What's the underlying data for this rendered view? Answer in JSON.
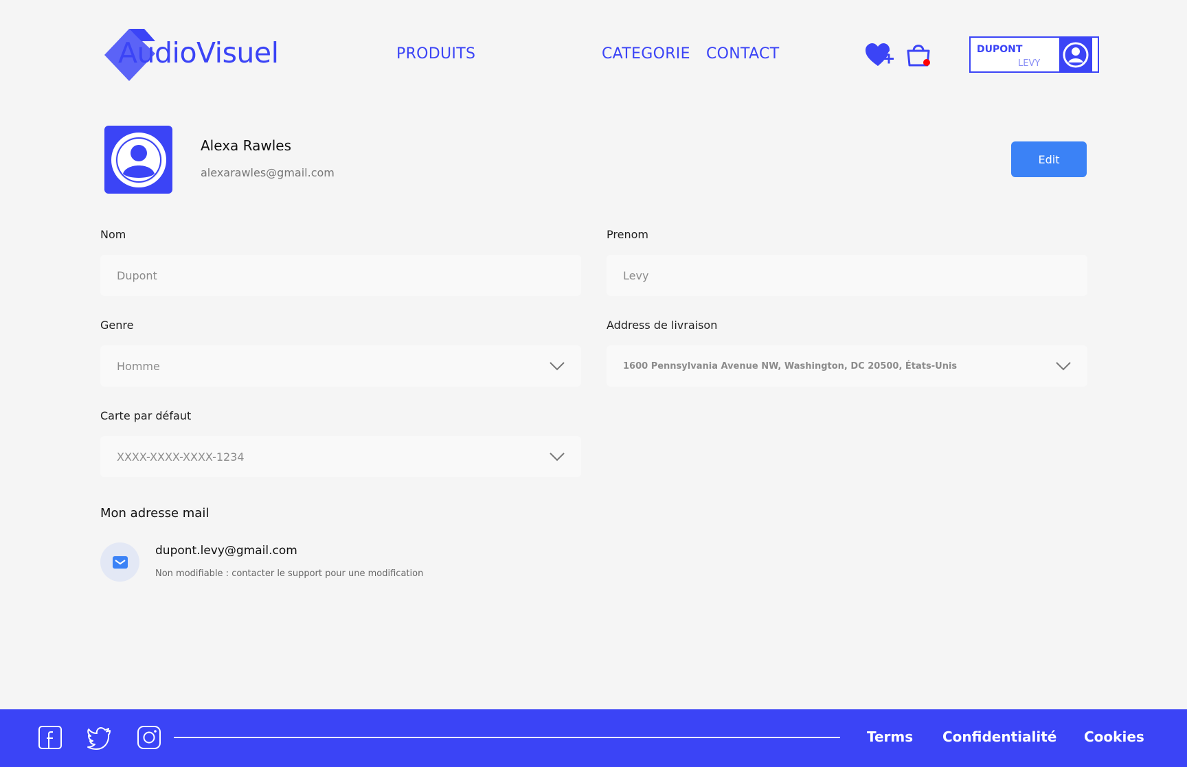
{
  "header": {
    "logo_text": "AudioVisuel",
    "nav": {
      "produits": "PRODUITS",
      "categorie": "CATEGORIE",
      "contact": "CONTACT"
    },
    "user": {
      "last_name": "DUPONT",
      "first_name": "LEVY"
    }
  },
  "profile": {
    "name": "Alexa Rawles",
    "email": "alexarawles@gmail.com",
    "edit_label": "Edit"
  },
  "form": {
    "nom": {
      "label": "Nom",
      "placeholder": "Dupont"
    },
    "prenom": {
      "label": "Prenom",
      "placeholder": "Levy"
    },
    "genre": {
      "label": "Genre",
      "value": "Homme"
    },
    "address": {
      "label": "Address de livraison",
      "value": "1600 Pennsylvania Avenue NW, Washington, DC 20500, États-Unis"
    },
    "carte": {
      "label": "Carte par défaut",
      "value": "XXXX-XXXX-XXXX-1234"
    }
  },
  "mail_section": {
    "title": "Mon adresse mail",
    "address": "dupont.levy@gmail.com",
    "note": "Non modifiable : contacter le support pour une modification"
  },
  "footer": {
    "terms": "Terms",
    "confidentialite": "Confidentialité",
    "cookies": "Cookies"
  },
  "colors": {
    "brand": "#3b44f6",
    "edit_button": "#3b82f6",
    "cart_badge": "#ff0000"
  }
}
